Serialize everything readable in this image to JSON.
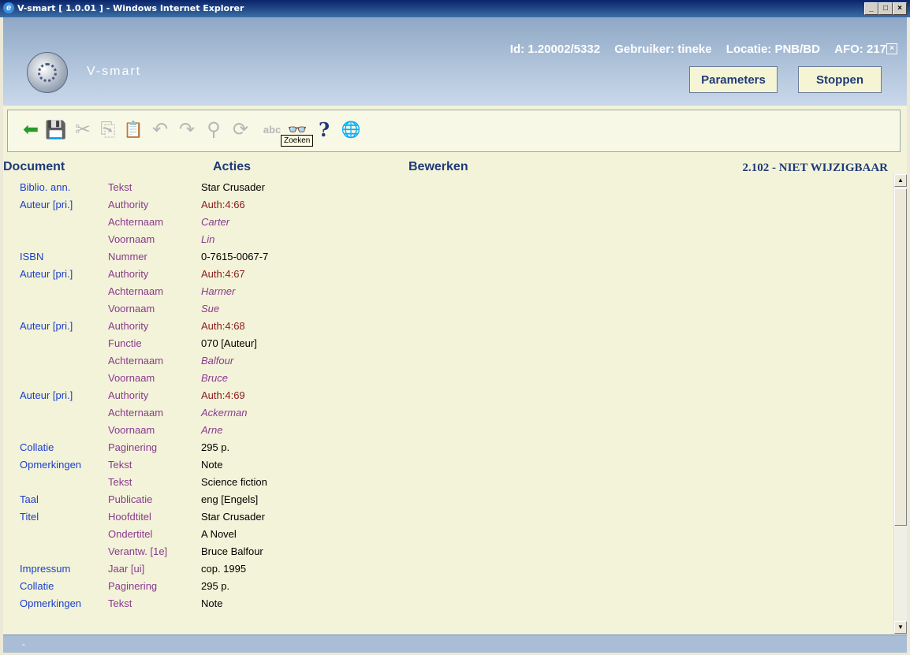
{
  "window": {
    "title": "V-smart [ 1.0.01 ] - Windows Internet Explorer",
    "min": "_",
    "max": "□",
    "close": "×"
  },
  "header": {
    "brand": "V-smart",
    "id": "Id: 1.20002/5332",
    "user": "Gebruiker: tineke",
    "location": "Locatie: PNB/BD",
    "afo": "AFO: 217",
    "close": "×",
    "buttons": {
      "parameters": "Parameters",
      "stop": "Stoppen"
    }
  },
  "toolbar": {
    "tooltip": "Zoeken",
    "icons": {
      "back": "back-arrow-icon",
      "save": "save-icon",
      "cut": "cut-icon",
      "copy": "copy-icon",
      "paste": "paste-icon",
      "undo": "undo-icon",
      "redo": "redo-icon",
      "find": "binoculars-icon",
      "refresh": "refresh-icon",
      "spell": "spellcheck-icon",
      "view": "glasses-icon",
      "help": "help-icon",
      "search": "search-globe-icon"
    },
    "glyphs": {
      "back": "⬅",
      "save": "💾",
      "cut": "✂",
      "copy": "⎘",
      "paste": "📋",
      "undo": "↶",
      "redo": "↷",
      "find": "⚲",
      "refresh": "⟳",
      "spell": "abc",
      "view": "👓",
      "help": "?",
      "search": "🌐"
    }
  },
  "columns": {
    "document": "Document",
    "actions": "Acties",
    "edit": "Bewerken",
    "status": "2.102 - NIET WIJZIGBAAR"
  },
  "rows": [
    {
      "field": "Biblio. ann.",
      "sub": "Tekst",
      "value": "Star Crusader",
      "style": "plain"
    },
    {
      "field": "Auteur [pri.]",
      "sub": "Authority",
      "value": "Auth:4:66",
      "style": "auth"
    },
    {
      "field": "",
      "sub": "Achternaam",
      "value": "Carter",
      "style": "it"
    },
    {
      "field": "",
      "sub": "Voornaam",
      "value": "Lin",
      "style": "it"
    },
    {
      "field": "ISBN",
      "sub": "Nummer",
      "value": "0-7615-0067-7",
      "style": "plain"
    },
    {
      "field": "Auteur [pri.]",
      "sub": "Authority",
      "value": "Auth:4:67",
      "style": "auth"
    },
    {
      "field": "",
      "sub": "Achternaam",
      "value": "Harmer",
      "style": "it"
    },
    {
      "field": "",
      "sub": "Voornaam",
      "value": "Sue",
      "style": "it"
    },
    {
      "field": "Auteur [pri.]",
      "sub": "Authority",
      "value": "Auth:4:68",
      "style": "auth"
    },
    {
      "field": "",
      "sub": "Functie",
      "value": "070 [Auteur]",
      "style": "plain"
    },
    {
      "field": "",
      "sub": "Achternaam",
      "value": "Balfour",
      "style": "it"
    },
    {
      "field": "",
      "sub": "Voornaam",
      "value": "Bruce",
      "style": "it"
    },
    {
      "field": "Auteur [pri.]",
      "sub": "Authority",
      "value": "Auth:4:69",
      "style": "auth"
    },
    {
      "field": "",
      "sub": "Achternaam",
      "value": "Ackerman",
      "style": "it"
    },
    {
      "field": "",
      "sub": "Voornaam",
      "value": "Arne",
      "style": "it"
    },
    {
      "field": "Collatie",
      "sub": "Paginering",
      "value": "295 p.",
      "style": "plain"
    },
    {
      "field": "Opmerkingen",
      "sub": "Tekst",
      "value": "Note",
      "style": "plain"
    },
    {
      "field": "",
      "sub": "Tekst",
      "value": "Science fiction",
      "style": "plain"
    },
    {
      "field": "Taal",
      "sub": "Publicatie",
      "value": "eng [Engels]",
      "style": "plain"
    },
    {
      "field": "Titel",
      "sub": "Hoofdtitel",
      "value": "Star Crusader",
      "style": "plain"
    },
    {
      "field": "",
      "sub": "Ondertitel",
      "value": "A Novel",
      "style": "plain"
    },
    {
      "field": "",
      "sub": "Verantw. [1e]",
      "value": "Bruce Balfour",
      "style": "plain"
    },
    {
      "field": "Impressum",
      "sub": "Jaar [ui]",
      "value": "cop. 1995",
      "style": "plain"
    },
    {
      "field": "Collatie",
      "sub": "Paginering",
      "value": "295 p.",
      "style": "plain"
    },
    {
      "field": "Opmerkingen",
      "sub": "Tekst",
      "value": "Note",
      "style": "plain"
    }
  ],
  "statusbar": {
    "text": "-"
  }
}
